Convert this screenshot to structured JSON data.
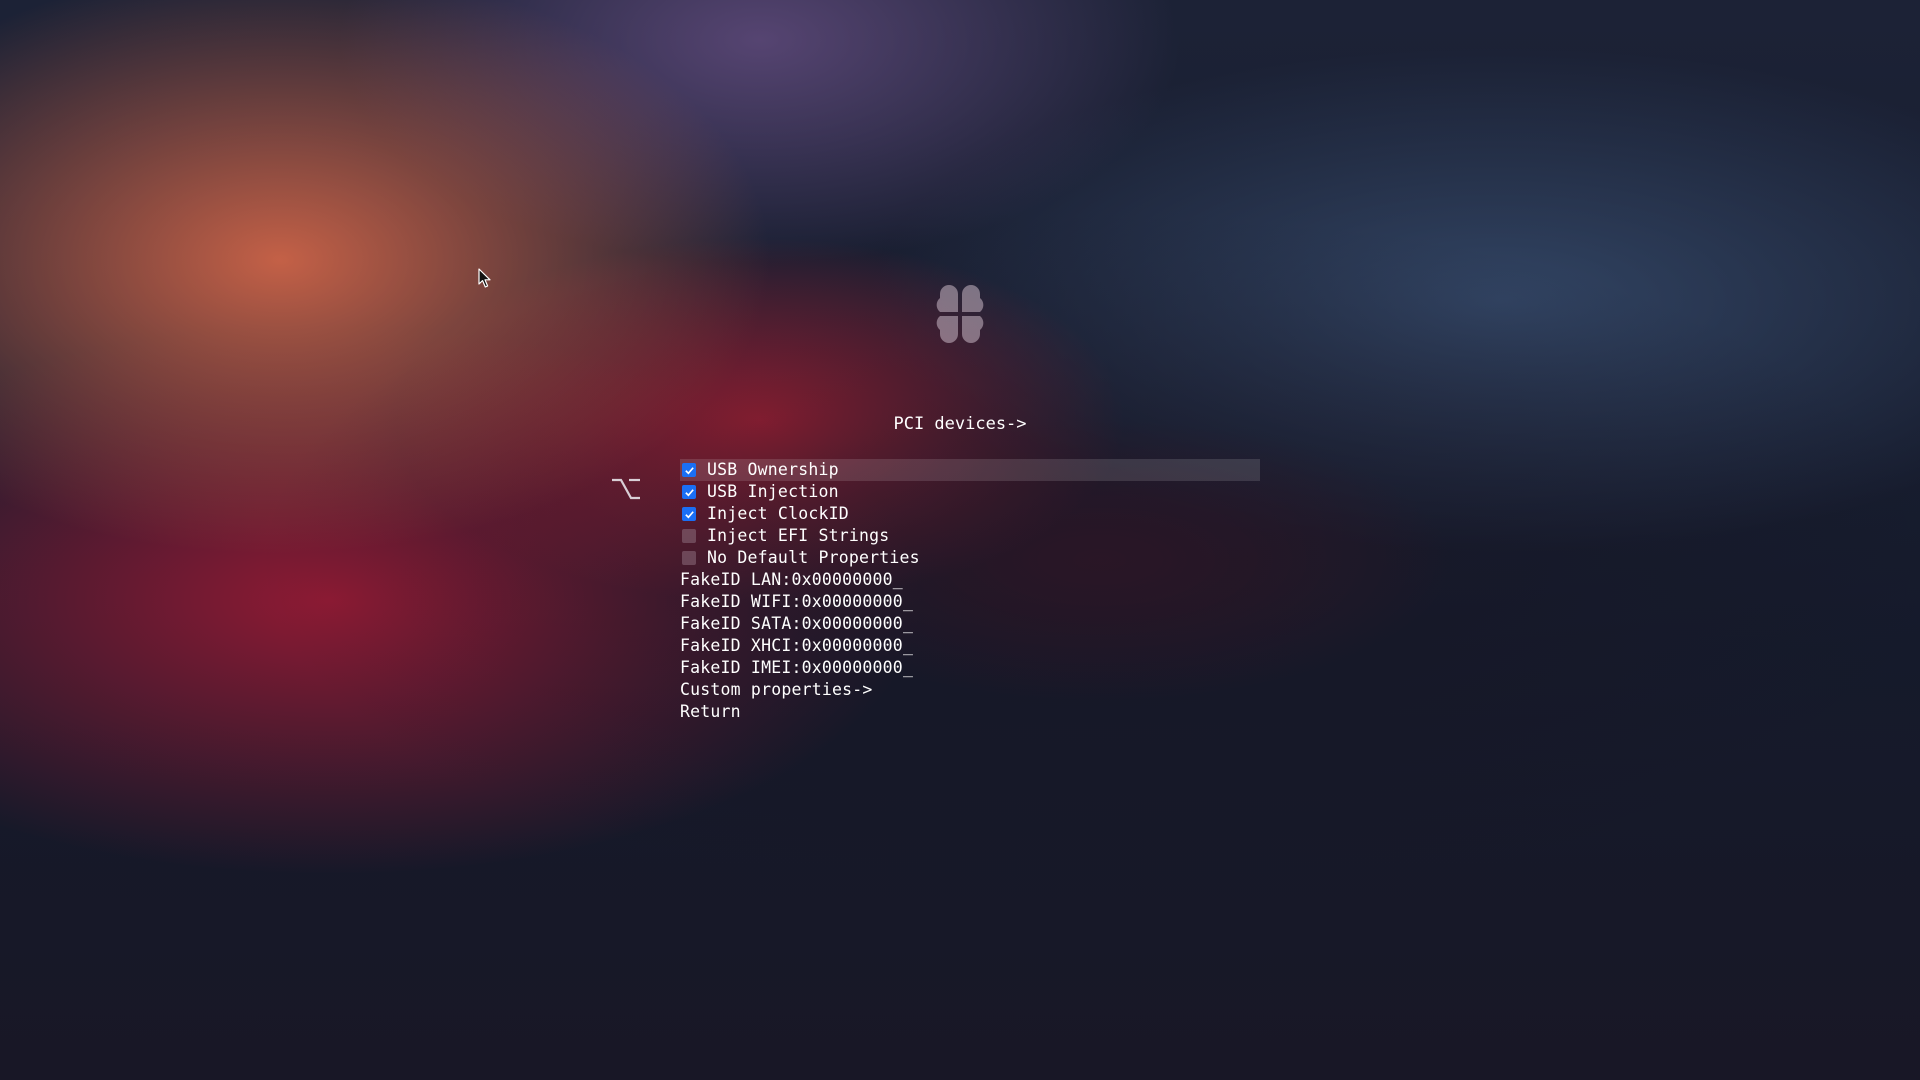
{
  "menu": {
    "title": "PCI devices->",
    "items": [
      {
        "type": "checkbox",
        "label": "USB Ownership",
        "checked": true,
        "selected": true
      },
      {
        "type": "checkbox",
        "label": "USB Injection",
        "checked": true,
        "selected": false
      },
      {
        "type": "checkbox",
        "label": "Inject ClockID",
        "checked": true,
        "selected": false
      },
      {
        "type": "checkbox",
        "label": "Inject EFI Strings",
        "checked": false,
        "selected": false
      },
      {
        "type": "checkbox",
        "label": "No Default Properties",
        "checked": false,
        "selected": false
      },
      {
        "type": "input",
        "label": "FakeID LAN:0x00000000_"
      },
      {
        "type": "input",
        "label": "FakeID WIFI:0x00000000_"
      },
      {
        "type": "input",
        "label": "FakeID SATA:0x00000000_"
      },
      {
        "type": "input",
        "label": "FakeID XHCI:0x00000000_"
      },
      {
        "type": "input",
        "label": "FakeID IMEI:0x00000000_"
      },
      {
        "type": "link",
        "label": "Custom properties->"
      },
      {
        "type": "link",
        "label": "Return"
      }
    ]
  },
  "icons": {
    "logo": "clover-logo-icon",
    "option_key": "option-key-icon",
    "cursor": "mouse-cursor-icon",
    "checkmark": "checkmark-icon"
  },
  "colors": {
    "checkbox_on": "#1a6ff5",
    "checkbox_off": "#8c6e7d",
    "text": "#ffffff"
  }
}
